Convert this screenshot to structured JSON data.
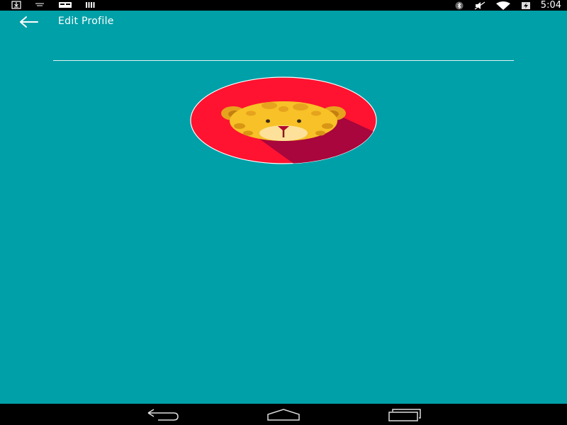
{
  "status_bar": {
    "time": "5:04",
    "left_icons": [
      "download-icon",
      "voicemail-icon",
      "sd-card-icon",
      "barcode-icon"
    ],
    "right_icons": [
      "bluetooth-icon",
      "mute-icon",
      "wifi-icon",
      "battery-charging-icon"
    ]
  },
  "toolbar": {
    "title": "Edit Profile",
    "back_icon": "arrow-back-icon"
  },
  "profile": {
    "avatar_icon": "leopard-avatar-icon",
    "avatar_bg_color": "#ff1330",
    "avatar_face_color": "#f7c127"
  },
  "nav_bar": {
    "buttons": [
      "back-icon",
      "home-icon",
      "recents-icon"
    ]
  },
  "colors": {
    "background": "#00a0a8",
    "system_bars": "#000000",
    "text": "#ffffff"
  }
}
